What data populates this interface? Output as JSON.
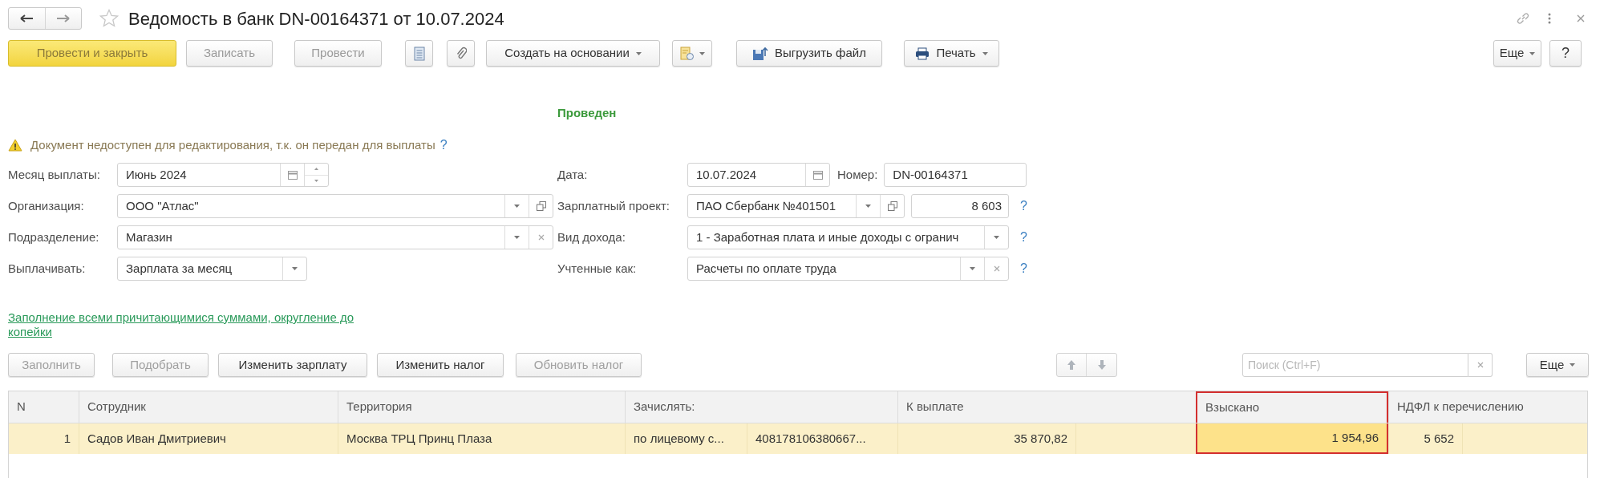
{
  "window": {
    "title": "Ведомость в банк DN-00164371 от 10.07.2024",
    "favorite": false
  },
  "toolbar": [
    {
      "kind": "primary",
      "label": "Провести и закрыть",
      "disabled": true
    },
    {
      "kind": "button",
      "label": "Записать",
      "disabled": true
    },
    {
      "kind": "button",
      "label": "Провести",
      "disabled": true
    },
    {
      "kind": "icon"
    },
    {
      "kind": "icon"
    },
    {
      "kind": "menu",
      "label": "Создать на основании",
      "disabled": false
    },
    {
      "kind": "icon_menu"
    },
    {
      "kind": "icon_text",
      "label": "Выгрузить файл",
      "disabled": false
    },
    {
      "kind": "icon_text_menu",
      "label": "Печать",
      "disabled": false
    }
  ],
  "more_menu": {
    "label": "Еще"
  },
  "help_button": {
    "label": "?"
  },
  "status": {
    "label": "Проведен"
  },
  "warning": {
    "text": "Документ недоступен для редактирования, т.к. он передан для выплаты",
    "help": "?"
  },
  "fields_left": [
    {
      "kind": "month",
      "label": "Месяц выплаты:",
      "value": "Июнь 2024"
    },
    {
      "kind": "select_open",
      "label": "Организация:",
      "value": "ООО \"Атлас\""
    },
    {
      "kind": "select_clear",
      "label": "Подразделение:",
      "value": "Магазин"
    },
    {
      "kind": "select",
      "label": "Выплачивать:",
      "value": "Зарплата за месяц"
    }
  ],
  "fields_right": [
    {
      "kind": "date_number",
      "label": "Дата:",
      "value": "10.07.2024",
      "number_label": "Номер:",
      "number": "DN-00164371"
    },
    {
      "kind": "project",
      "label": "Зарплатный проект:",
      "value": "ПАО Сбербанк №401501",
      "number": "8 603",
      "help": "?"
    },
    {
      "kind": "select",
      "label": "Вид дохода:",
      "value": "1 - Заработная плата и иные доходы с огранич",
      "help": "?"
    },
    {
      "kind": "select_clear",
      "label": "Учтенные как:",
      "value": "Расчеты по оплате труда",
      "help": "?"
    }
  ],
  "fill_link": {
    "label": "Заполнение всеми причитающимися суммами, округление до копейки"
  },
  "table_toolbar": {
    "buttons": [
      {
        "label": "Заполнить",
        "disabled": true
      },
      {
        "label": "Подобрать",
        "disabled": true
      },
      {
        "label": "Изменить зарплату",
        "disabled": false
      },
      {
        "label": "Изменить налог",
        "disabled": false
      },
      {
        "label": "Обновить налог",
        "disabled": true
      }
    ],
    "search": {
      "placeholder": "Поиск (Ctrl+F)"
    },
    "more_menu": {
      "label": "Еще"
    }
  },
  "table": {
    "columns": [
      {
        "label": "N",
        "highlighted": false
      },
      {
        "label": "Сотрудник",
        "highlighted": false
      },
      {
        "label": "Территория",
        "highlighted": false
      },
      {
        "label": "Зачислять:",
        "highlighted": false
      },
      {
        "label": "К выплате",
        "highlighted": false
      },
      {
        "label": "Взыскано",
        "highlighted": true
      },
      {
        "label": "НДФЛ к перечислению",
        "highlighted": false
      }
    ],
    "rows": [
      {
        "selected": true,
        "cells": [
          "1",
          "Садов Иван Дмитриевич",
          "Москва ТРЦ Принц Плаза",
          [
            "по лицевому с...",
            "408178106380667..."
          ],
          "35 870,82",
          "1 954,96",
          "5 652"
        ]
      }
    ]
  }
}
